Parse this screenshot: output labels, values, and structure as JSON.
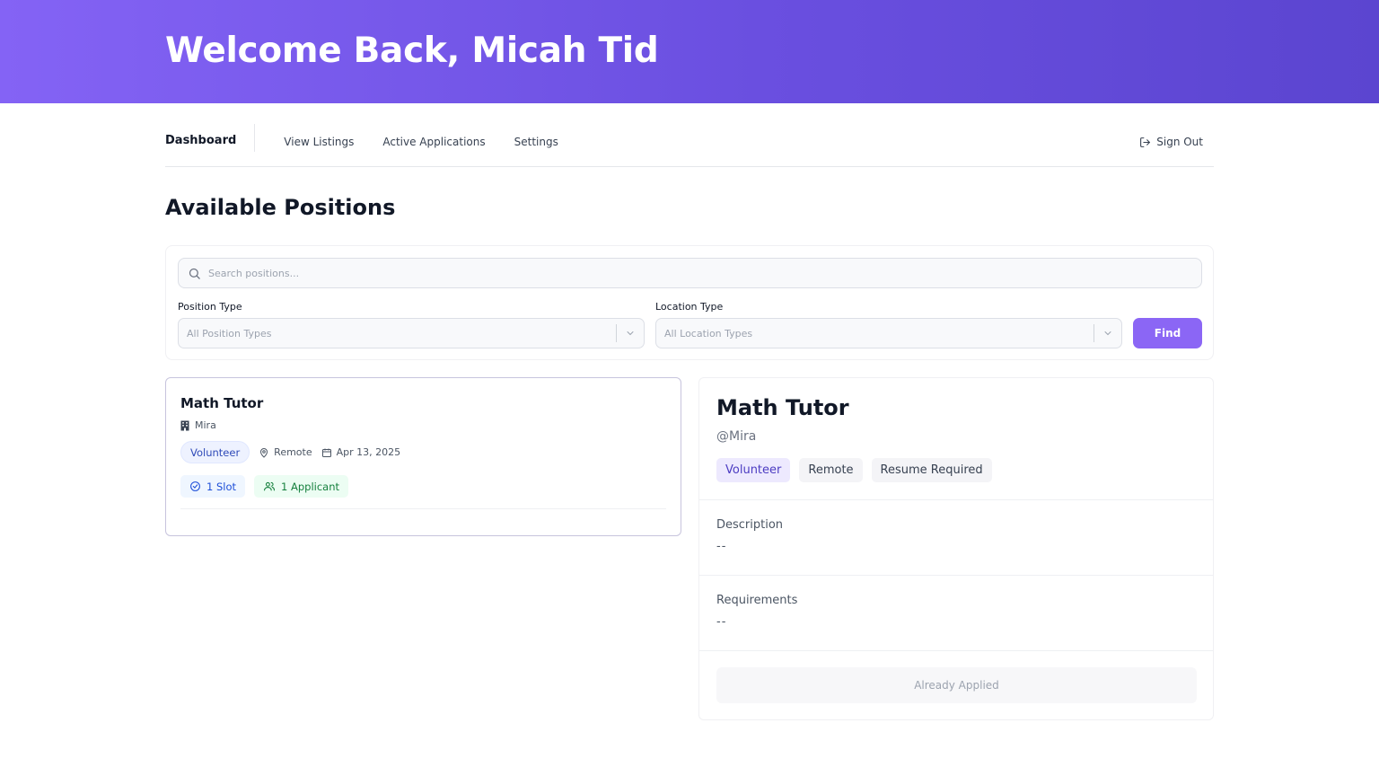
{
  "header": {
    "welcome": "Welcome Back, Micah Tid"
  },
  "nav": {
    "items": [
      {
        "label": "Dashboard",
        "active": true
      },
      {
        "label": "View Listings"
      },
      {
        "label": "Active Applications"
      },
      {
        "label": "Settings"
      }
    ],
    "sign_out": "Sign Out"
  },
  "page": {
    "title": "Available Positions"
  },
  "filters": {
    "search_placeholder": "Search positions...",
    "position_type_label": "Position Type",
    "position_type_value": "All Position Types",
    "location_type_label": "Location Type",
    "location_type_value": "All Location Types",
    "find_label": "Find"
  },
  "listing": {
    "title": "Math Tutor",
    "org": "Mira",
    "type": "Volunteer",
    "location": "Remote",
    "date": "Apr 13, 2025",
    "slots": "1 Slot",
    "applicants": "1 Applicant"
  },
  "detail": {
    "title": "Math Tutor",
    "handle": "@Mira",
    "tags": [
      "Volunteer",
      "Remote",
      "Resume Required"
    ],
    "description_label": "Description",
    "description_value": "--",
    "requirements_label": "Requirements",
    "requirements_value": "--",
    "applied_label": "Already Applied"
  },
  "colors": {
    "accent": "#8b66f5",
    "hero_start": "#8463f5",
    "hero_end": "#5b45d0"
  }
}
